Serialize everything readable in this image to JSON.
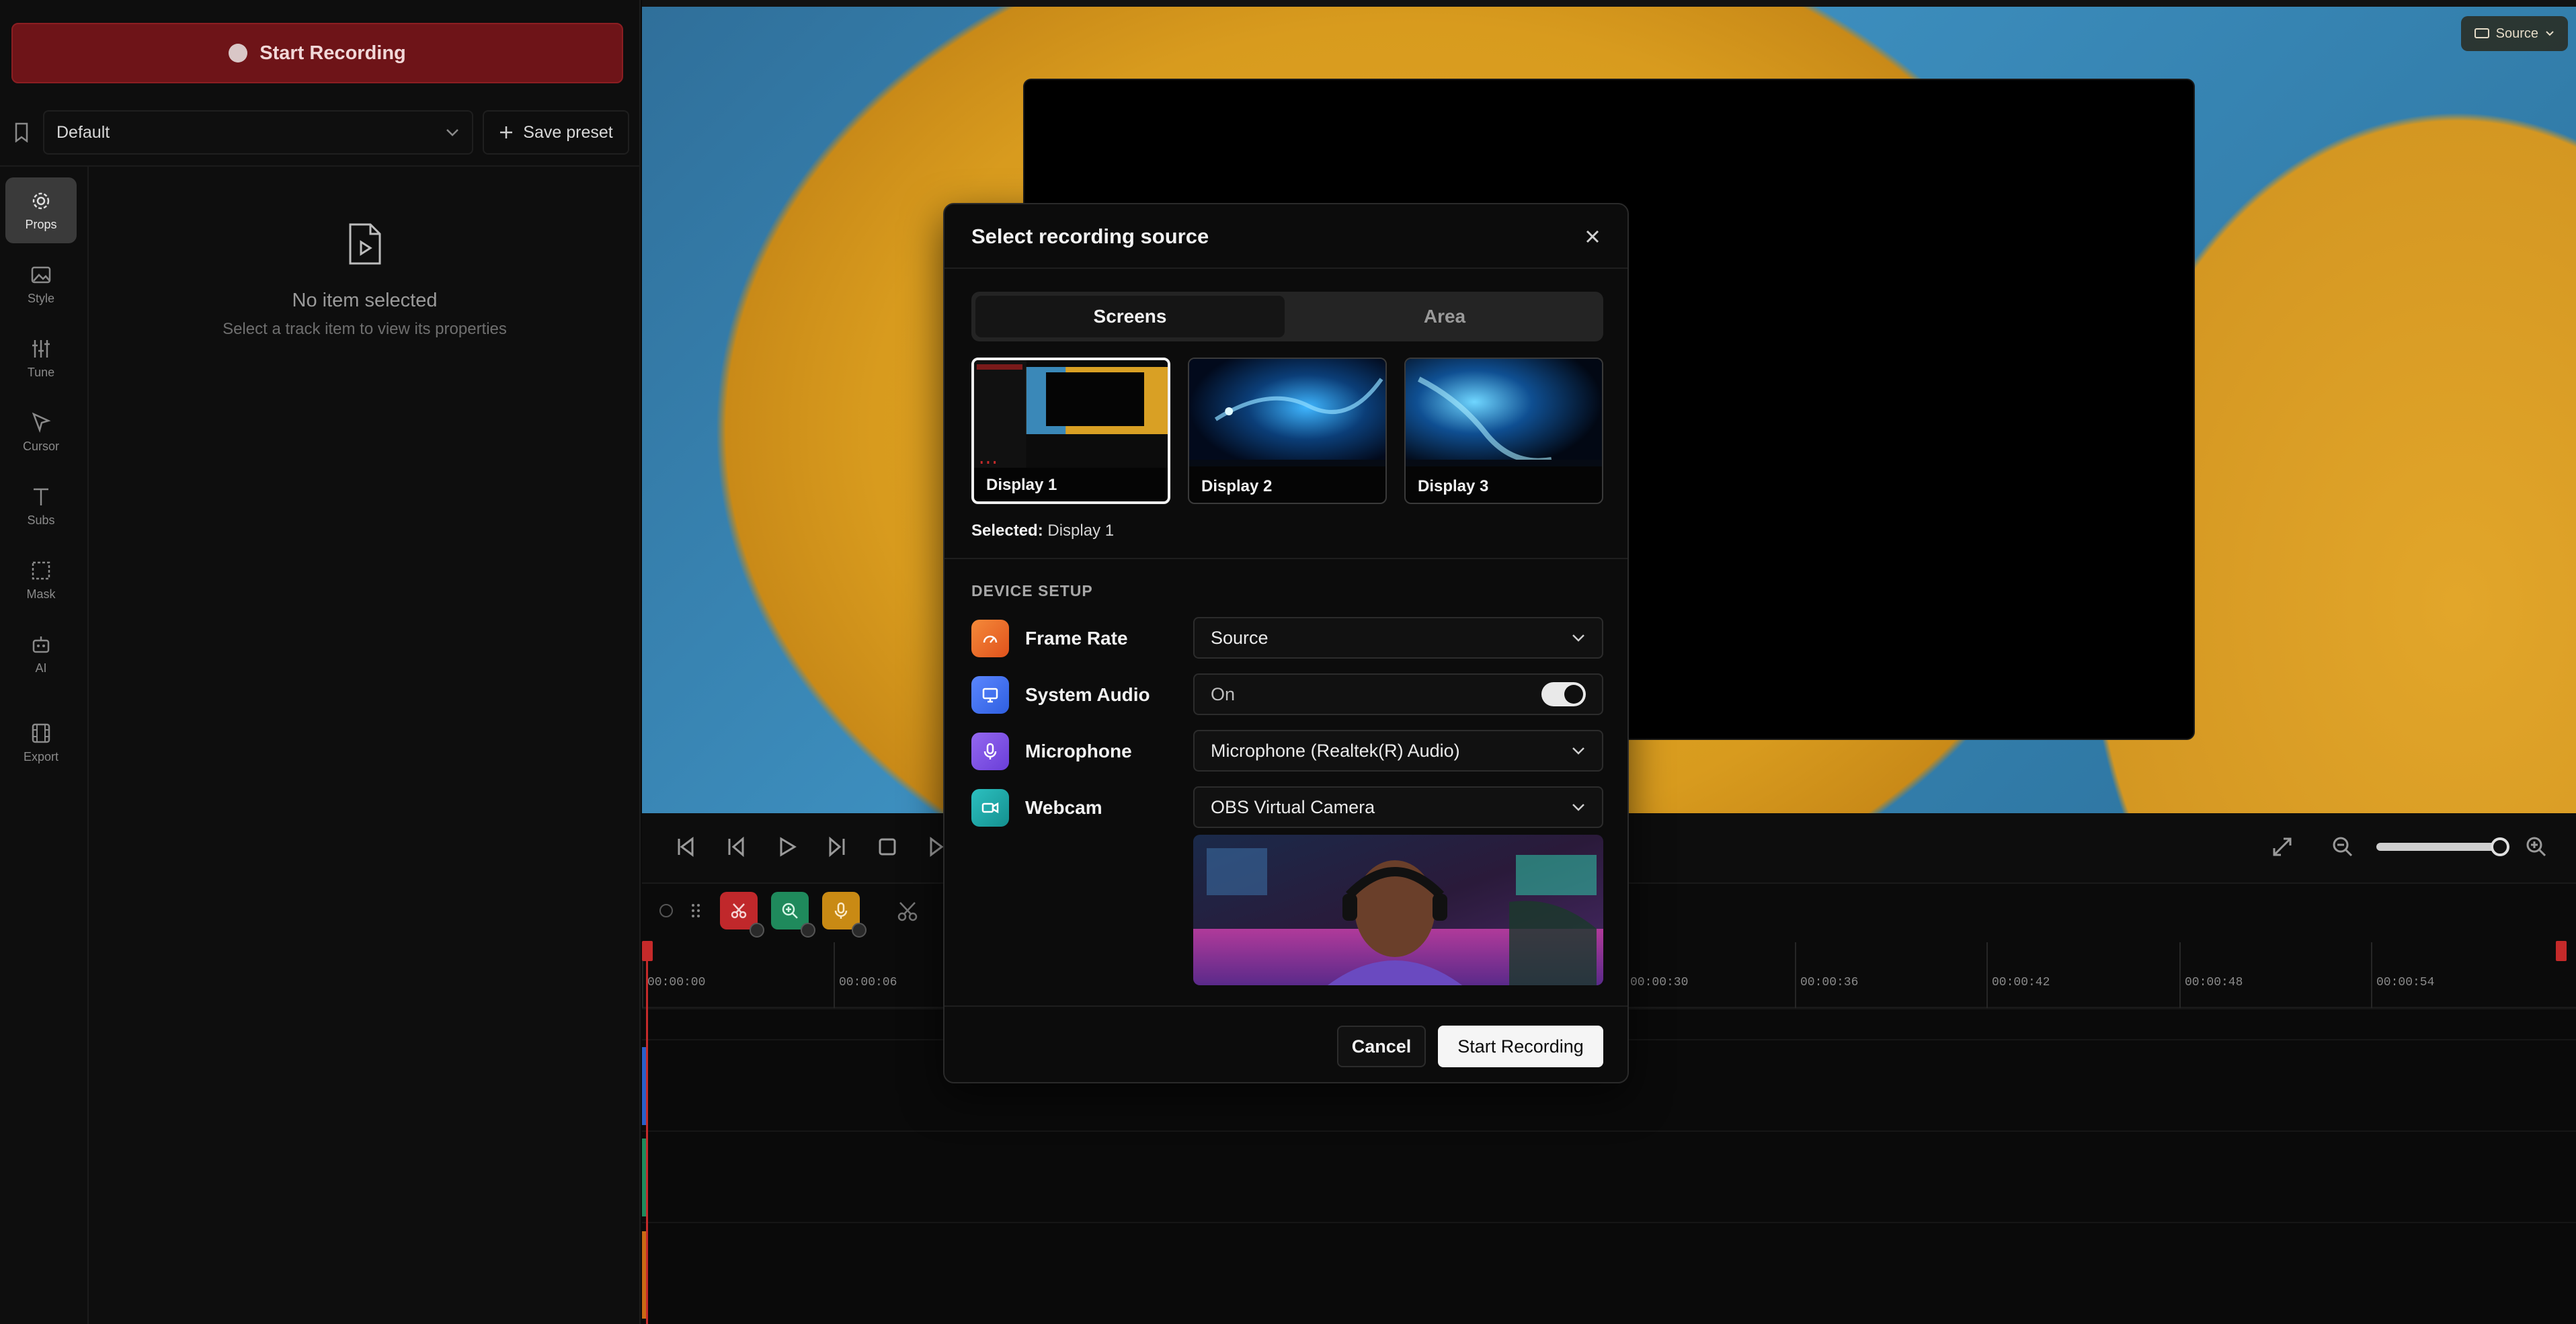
{
  "left_panel": {
    "record_button": "Start Recording",
    "preset_value": "Default",
    "save_preset": "Save preset",
    "rail": [
      {
        "label": "Props",
        "icon": "gear-icon"
      },
      {
        "label": "Style",
        "icon": "image-icon"
      },
      {
        "label": "Tune",
        "icon": "sliders-icon"
      },
      {
        "label": "Cursor",
        "icon": "cursor-icon"
      },
      {
        "label": "Subs",
        "icon": "text-icon"
      },
      {
        "label": "Mask",
        "icon": "mask-icon"
      },
      {
        "label": "AI",
        "icon": "robot-icon"
      },
      {
        "label": "Export",
        "icon": "film-icon"
      }
    ],
    "empty_title": "No item selected",
    "empty_subtitle": "Select a track item to view its properties"
  },
  "preview": {
    "source_chip": "Source"
  },
  "timeline": {
    "ticks": [
      "00:00:00",
      "00:00:06",
      "",
      "",
      "",
      "00:00:30",
      "00:00:36",
      "00:00:42",
      "00:00:48",
      "00:00:54"
    ]
  },
  "modal": {
    "title": "Select recording source",
    "tabs": [
      "Screens",
      "Area"
    ],
    "displays": [
      "Display 1",
      "Display 2",
      "Display 3"
    ],
    "selected_label": "Selected:",
    "selected_value": "Display 1",
    "device_setup_title": "DEVICE SETUP",
    "devices": [
      {
        "label": "Frame Rate",
        "value": "Source",
        "color": "#f06a2a"
      },
      {
        "label": "System Audio",
        "value": "On",
        "color": "#3a6ef0"
      },
      {
        "label": "Microphone",
        "value": "Microphone (Realtek(R) Audio)",
        "color": "#7a4fe0"
      },
      {
        "label": "Webcam",
        "value": "OBS Virtual Camera",
        "color": "#1aa3a3"
      }
    ],
    "cancel": "Cancel",
    "start": "Start Recording"
  },
  "colors": {
    "accent_red": "#6e1418",
    "playhead": "#c52a2a"
  }
}
